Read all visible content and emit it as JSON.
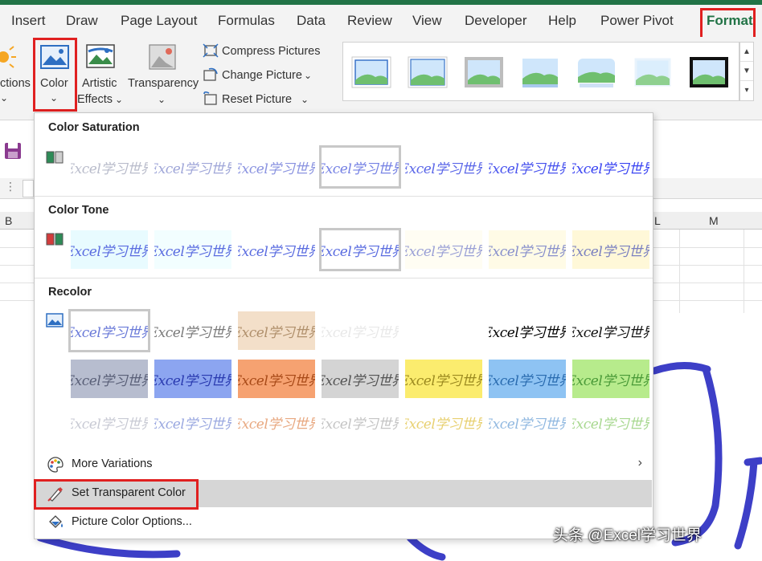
{
  "tabs": [
    "Insert",
    "Draw",
    "Page Layout",
    "Formulas",
    "Data",
    "Review",
    "View",
    "Developer",
    "Help",
    "Power Pivot",
    "Format"
  ],
  "ribbon": {
    "corrections_label": "ctions",
    "color_label": "Color",
    "artistic_label_1": "Artistic",
    "artistic_label_2": "Effects",
    "transparency_label": "Transparency",
    "compress_label": "Compress Pictures",
    "change_label": "Change Picture",
    "reset_label": "Reset Picture",
    "chevron": "⌄"
  },
  "sheet": {
    "col_b": "B",
    "col_l": "L",
    "col_m": "M"
  },
  "dropdown": {
    "saturation_title": "Color Saturation",
    "tone_title": "Color Tone",
    "recolor_title": "Recolor",
    "swatch_text": "Excel学习世界",
    "more_variations": "More Variations",
    "set_transparent": "Set Transparent Color",
    "picture_color_options": "Picture Color Options..."
  },
  "watermark": "头条 @Excel学习世界",
  "colors": {
    "accent_green": "#217346",
    "highlight_red": "#e02020",
    "ink_blue": "#3d3fc7"
  },
  "saturation_colors": [
    "#b9bccb",
    "#9fa6d8",
    "#8a93e0",
    "#7682e4",
    "#5a66e8",
    "#4752ee",
    "#3a44f2"
  ],
  "tone_swatches": [
    {
      "ink": "#5a6ce0",
      "bg": "#e8fbff"
    },
    {
      "ink": "#5a6ce0",
      "bg": "#f2feff"
    },
    {
      "ink": "#5a6ce0",
      "bg": "#ffffff"
    },
    {
      "ink": "#5a6ce0",
      "bg": "#ffffff"
    },
    {
      "ink": "#9aa0d6",
      "bg": "#fffdf3"
    },
    {
      "ink": "#8890cc",
      "bg": "#fffbe6"
    },
    {
      "ink": "#7a80c0",
      "bg": "#fff8d8"
    }
  ],
  "recolor_row1": [
    {
      "ink": "#6a7ad8",
      "bg": "#ffffff"
    },
    {
      "ink": "#7a7a7a",
      "bg": "#ffffff"
    },
    {
      "ink": "#b0906c",
      "bg": "#f3dfc9"
    },
    {
      "ink": "#e8e8e8",
      "bg": "#ffffff"
    },
    {
      "ink": "#ffffff",
      "bg": "#ffffff"
    },
    {
      "ink": "#000000",
      "bg": "#ffffff"
    },
    {
      "ink": "#111111",
      "bg": "#ffffff"
    }
  ],
  "recolor_row2": [
    {
      "ink": "#5a6078",
      "bg": "#b7bdcf"
    },
    {
      "ink": "#2a3bb0",
      "bg": "#8ca5f0"
    },
    {
      "ink": "#a84a18",
      "bg": "#f6a271"
    },
    {
      "ink": "#555555",
      "bg": "#d4d4d4"
    },
    {
      "ink": "#9c8a20",
      "bg": "#fbec6e"
    },
    {
      "ink": "#2a6cb0",
      "bg": "#8ec3f3"
    },
    {
      "ink": "#4a9a38",
      "bg": "#b7eb8c"
    }
  ],
  "recolor_row3": [
    {
      "ink": "#c8cad4",
      "bg": "#ffffff"
    },
    {
      "ink": "#9aa8e0",
      "bg": "#ffffff"
    },
    {
      "ink": "#e8a880",
      "bg": "#ffffff"
    },
    {
      "ink": "#c4c4c4",
      "bg": "#ffffff"
    },
    {
      "ink": "#e8d070",
      "bg": "#ffffff"
    },
    {
      "ink": "#90b8e0",
      "bg": "#ffffff"
    },
    {
      "ink": "#a8d890",
      "bg": "#ffffff"
    }
  ]
}
